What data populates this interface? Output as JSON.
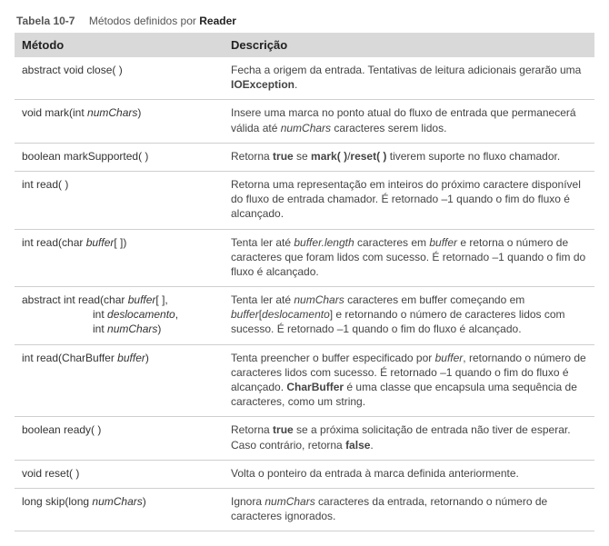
{
  "caption": {
    "label": "Tabela 10-7",
    "text_prefix": "Métodos definidos por ",
    "text_bold": "Reader"
  },
  "headers": {
    "method": "Método",
    "description": "Descrição"
  },
  "rows": [
    {
      "method_html": "abstract void close( )",
      "desc_html": "Fecha a origem da entrada. Tentativas de leitura adicionais gerarão uma <span class=\"bold\">IOException</span>."
    },
    {
      "method_html": "void mark(int <span class=\"ital\">numChars</span>)",
      "desc_html": "Insere uma marca no ponto atual do fluxo de entrada que permanecerá válida até <span class=\"ital\">numChars</span> caracteres serem lidos."
    },
    {
      "method_html": "boolean markSupported( )",
      "desc_html": "Retorna <span class=\"bold\">true</span> se <span class=\"bold\">mark( )</span>/<span class=\"bold\">reset( )</span> tiverem suporte no fluxo chamador."
    },
    {
      "method_html": "int read( )",
      "desc_html": "Retorna uma representação em inteiros do próximo caractere disponível do fluxo de entrada chamador. É retornado –1 quando o fim do fluxo é alcançado."
    },
    {
      "method_html": "int read(char <span class=\"ital\">buffer</span>[ ])",
      "desc_html": "Tenta ler até <span class=\"ital\">buffer.length</span> caracteres em <span class=\"ital\">buffer</span> e retorna o número de caracteres que foram lidos com sucesso. É retornado –1 quando o fim do fluxo é alcançado."
    },
    {
      "method_html": "abstract int read(char <span class=\"ital\">buffer</span>[ ],<span class=\"param-indent\">int <span class=\"ital\">deslocamento</span>,</span><span class=\"param-indent\">int <span class=\"ital\">numChars</span>)</span>",
      "desc_html": "Tenta ler até <span class=\"ital\">numChars</span> caracteres em buffer começando em <span class=\"ital\">buffer</span>[<span class=\"ital\">deslocamento</span>] e retornando o número de caracteres lidos com sucesso. É retornado –1 quando o fim do fluxo é alcançado."
    },
    {
      "method_html": "int read(CharBuffer <span class=\"ital\">buffer</span>)",
      "desc_html": "Tenta preencher o buffer especificado por <span class=\"ital\">buffer</span>, retornando o número de caracteres lidos com sucesso. É retornado –1 quando o fim do fluxo é alcançado. <span class=\"bold\">CharBuffer</span> é uma classe que encapsula uma sequência de caracteres, como um string."
    },
    {
      "method_html": "boolean ready( )",
      "desc_html": "Retorna <span class=\"bold\">true</span> se a próxima solicitação de entrada não tiver de esperar. Caso contrário, retorna <span class=\"bold\">false</span>."
    },
    {
      "method_html": "void reset( )",
      "desc_html": "Volta o ponteiro da entrada à marca definida anteriormente."
    },
    {
      "method_html": "long skip(long <span class=\"ital\">numChars</span>)",
      "desc_html": "Ignora <span class=\"ital\">numChars</span> caracteres da entrada, retornando o número de caracteres ignorados."
    }
  ]
}
